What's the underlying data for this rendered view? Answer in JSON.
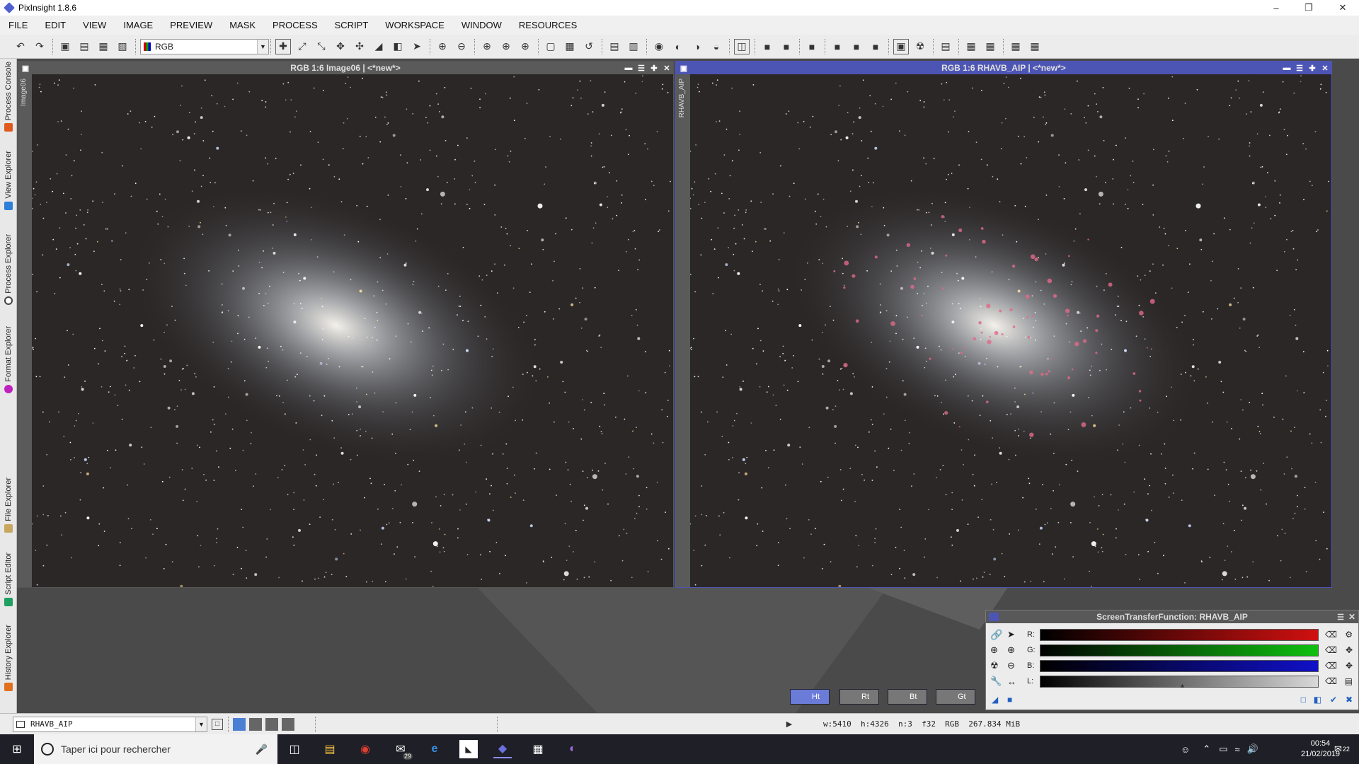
{
  "app": {
    "title": "PixInsight 1.8.6"
  },
  "menu": [
    "FILE",
    "EDIT",
    "VIEW",
    "IMAGE",
    "PREVIEW",
    "MASK",
    "PROCESS",
    "SCRIPT",
    "WORKSPACE",
    "WINDOW",
    "RESOURCES"
  ],
  "toolbar": {
    "color_mode": "RGB"
  },
  "left_tabs": [
    {
      "label": "Process Console",
      "color": "#e05a20"
    },
    {
      "label": "View Explorer",
      "color": "#2d7fd8"
    },
    {
      "label": "Process Explorer",
      "color": "#555555"
    },
    {
      "label": "Format Explorer",
      "color": "#c020c0"
    },
    {
      "label": "File Explorer",
      "color": "#c8a860"
    },
    {
      "label": "Script Editor",
      "color": "#20a060"
    },
    {
      "label": "History Explorer",
      "color": "#e07020"
    }
  ],
  "windows": [
    {
      "title": "RGB 1:6 Image06 | <*new*>",
      "side_label": "Image06",
      "active": false
    },
    {
      "title": "RGB 1:6 RHAVB_AIP | <*new*>",
      "side_label": "RHAVB_AIP",
      "active": true
    }
  ],
  "desktop_icons": [
    {
      "label": "Ht"
    },
    {
      "label": "Rt"
    },
    {
      "label": "Bt"
    },
    {
      "label": "Gt"
    }
  ],
  "stf": {
    "title": "ScreenTransferFunction: RHAVB_AIP",
    "channels": [
      {
        "label": "R:",
        "color": "#d01010"
      },
      {
        "label": "G:",
        "color": "#10c010"
      },
      {
        "label": "B:",
        "color": "#1010c8"
      },
      {
        "label": "L:",
        "color": "#d8d8d8"
      }
    ]
  },
  "statusbar": {
    "view": "RHAVB_AIP",
    "info": "w:5410  h:4326  n:3  f32  RGB  267.834 MiB"
  },
  "taskbar": {
    "search_placeholder": "Taper ici pour rechercher",
    "mail_badge": "29",
    "time": "00:54",
    "date": "21/02/2019",
    "notif": "22"
  }
}
